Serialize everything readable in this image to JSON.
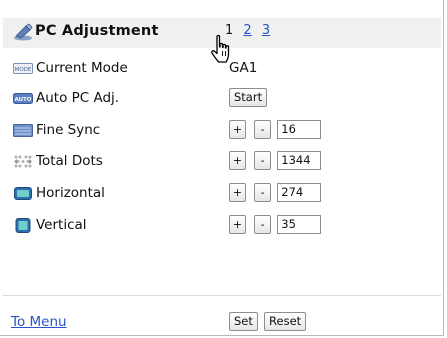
{
  "header": {
    "title": "PC Adjustment",
    "pages": [
      {
        "label": "1",
        "current": true
      },
      {
        "label": "2",
        "current": false
      },
      {
        "label": "3",
        "current": false
      }
    ]
  },
  "rows": {
    "current_mode": {
      "label": "Current Mode",
      "value": "GA1",
      "icon_text": "MODE"
    },
    "auto_pc_adj": {
      "label": "Auto PC Adj.",
      "button": "Start",
      "icon_text": "AUTO"
    },
    "fine_sync": {
      "label": "Fine Sync",
      "plus": "+",
      "minus": "-",
      "value": "16"
    },
    "total_dots": {
      "label": "Total Dots",
      "plus": "+",
      "minus": "-",
      "value": "1344"
    },
    "horizontal": {
      "label": "Horizontal",
      "plus": "+",
      "minus": "-",
      "value": "274"
    },
    "vertical": {
      "label": "Vertical",
      "plus": "+",
      "minus": "-",
      "value": "35"
    }
  },
  "footer": {
    "to_menu": "To Menu",
    "set": "Set",
    "reset": "Reset"
  },
  "colors": {
    "link": "#2a55c8",
    "header_bg": "#f0f0f0"
  }
}
